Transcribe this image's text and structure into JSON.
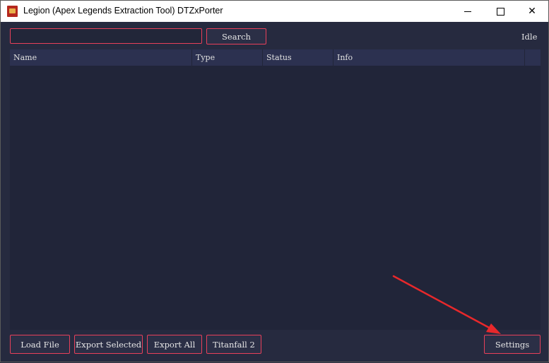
{
  "window": {
    "title": "Legion (Apex Legends Extraction Tool) DTZxPorter",
    "controls": {
      "minimize_icon": "minimize-icon",
      "maximize_icon": "maximize-icon",
      "close_icon": "close-icon"
    }
  },
  "toolbar": {
    "search_value": "",
    "search_label": "Search",
    "status": "Idle"
  },
  "table": {
    "columns": [
      "Name",
      "Type",
      "Status",
      "Info",
      ""
    ],
    "rows": []
  },
  "footer": {
    "load_file": "Load File",
    "export_selected": "Export Selected",
    "export_all": "Export All",
    "titanfall": "Titanfall 2",
    "settings": "Settings"
  },
  "annotation": {
    "arrow_color": "#e8282b"
  },
  "colors": {
    "accent": "#e8405a",
    "background": "#262a3f",
    "header": "#2c3150"
  }
}
